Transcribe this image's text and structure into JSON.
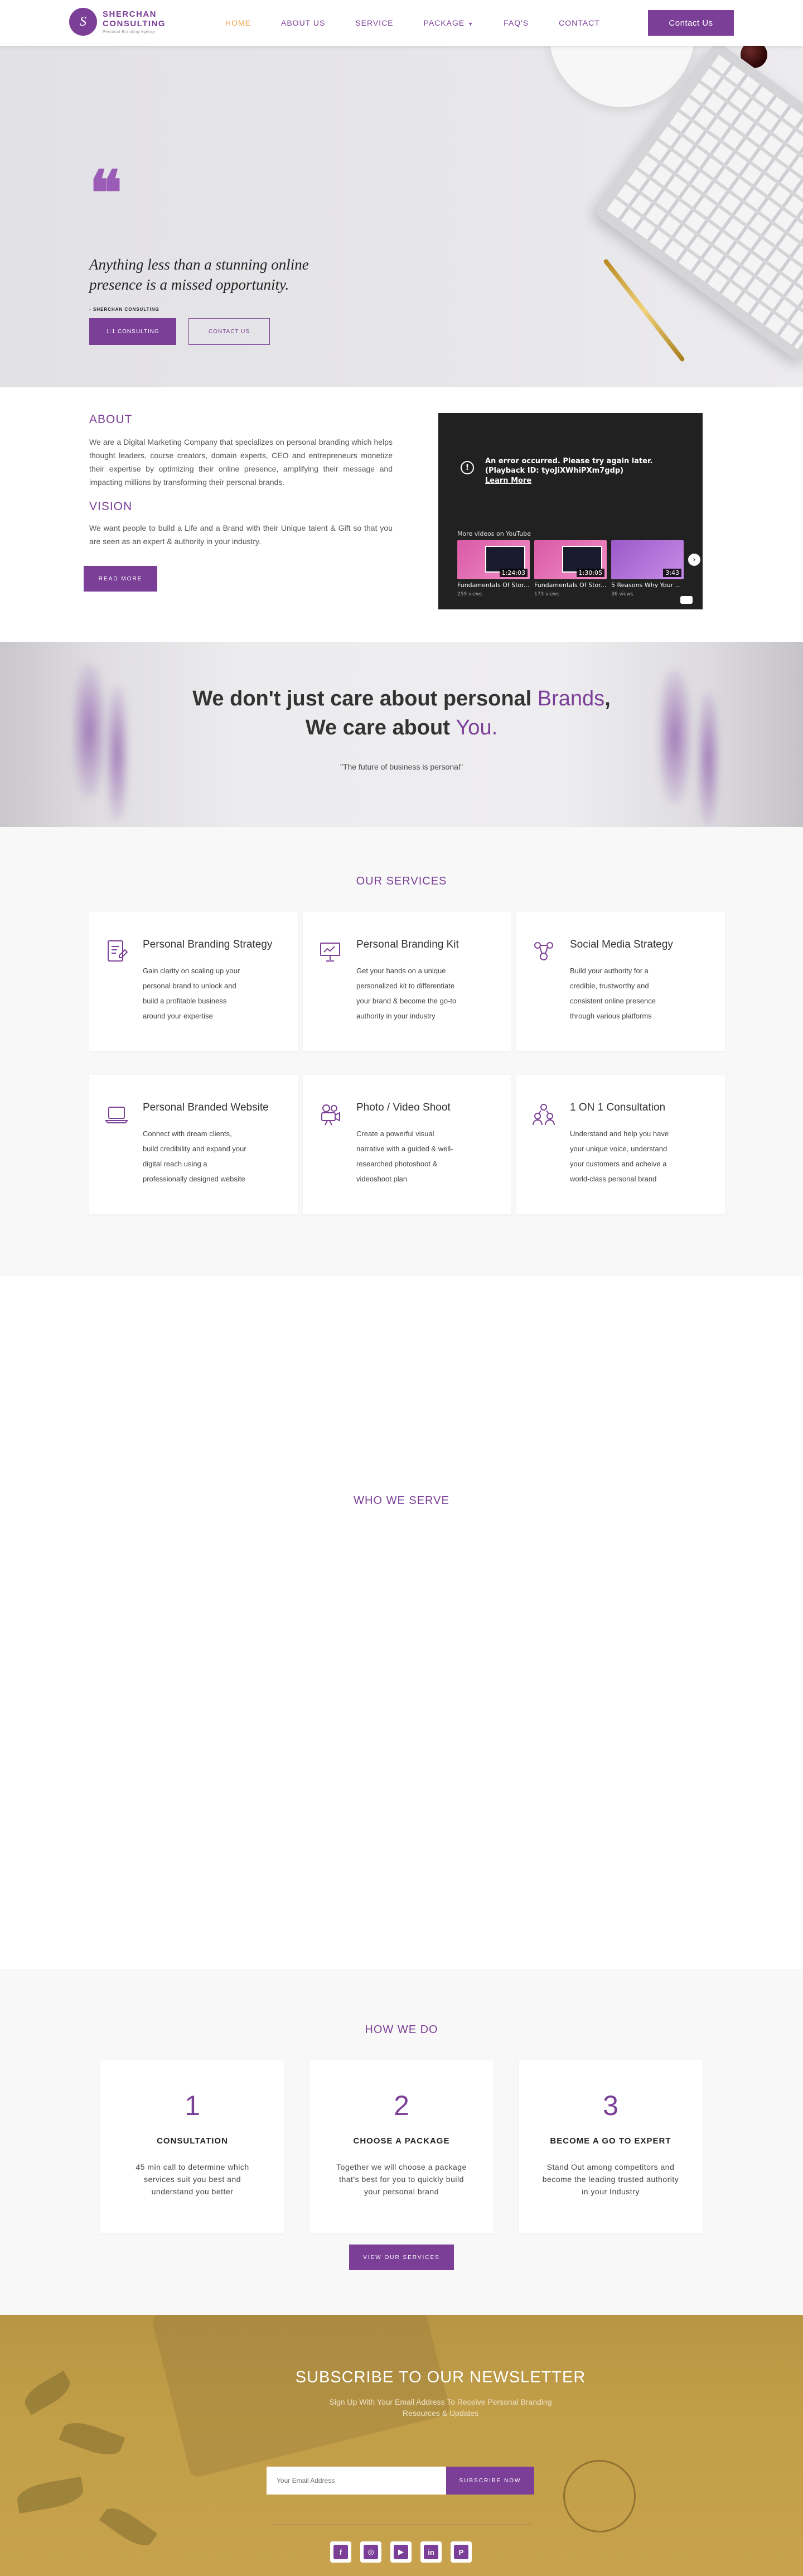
{
  "brand": {
    "mark": "S",
    "name_line1": "SHERCHAN",
    "name_line2": "CONSULTING",
    "tagline": "Personal Branding Agency"
  },
  "nav": {
    "items": [
      "HOME",
      "ABOUT US",
      "SERVICE",
      "PACKAGE",
      "FAQ'S",
      "CONTACT"
    ],
    "active": "HOME",
    "cta": "Contact Us"
  },
  "hero": {
    "quote_glyph": "❝",
    "quote": "Anything less than a stunning online presence is a missed opportunity.",
    "signature": "- SHERCHAN CONSULTING",
    "button_primary": "1:1 CONSULTING",
    "button_secondary": "CONTACT US"
  },
  "about": {
    "about_title": "ABOUT",
    "about_text": "We are a Digital Marketing Company that specializes on personal branding which helps thought leaders, course creators, domain experts, CEO and entrepreneurs monetize their expertise by optimizing their online presence, amplifying their message and impacting millions by transforming their personal brands.",
    "vision_title": "VISION",
    "vision_text": "We want people to build a Life and a Brand with their Unique talent & Gift so that you are seen as an expert & authority in your industry.",
    "read_more": "READ MORE"
  },
  "video": {
    "error": "An error occurred. Please try again later. (Playback ID: tyoJiXWhiPXm7gdp)",
    "learn_more": "Learn More",
    "more_videos": "More videos on YouTube",
    "thumbs": [
      {
        "title": "Fundamentals Of Stor...",
        "views": "259 views",
        "duration": "1:24:03"
      },
      {
        "title": "Fundamentals Of Stor...",
        "views": "173 views",
        "duration": "1:30:05"
      },
      {
        "title": "5 Reasons Why Your ...",
        "views": "36 views",
        "duration": "3:43"
      }
    ]
  },
  "banner": {
    "line1_a": "We don't just care about personal ",
    "line1_hl": "Brands",
    "line1_b": ",",
    "line2_a": "We care about ",
    "line2_hl": "You.",
    "subtitle": "\"The future of business is personal\""
  },
  "services": {
    "title": "OUR SERVICES",
    "cards": [
      {
        "icon": "strategy-document-icon",
        "title": "Personal Branding Strategy",
        "text": "Gain clarity on scaling up your personal brand to unlock and build a profitable business around your expertise"
      },
      {
        "icon": "presentation-board-icon",
        "title": "Personal Branding Kit",
        "text": "Get your hands on a unique personalized kit to differentiate your brand & become the go-to authority in your industry"
      },
      {
        "icon": "social-network-icon",
        "title": "Social Media Strategy",
        "text": "Build your authority for a credible, trustworthy and consistent online presence through various platforms"
      },
      {
        "icon": "laptop-icon",
        "title": "Personal Branded Website",
        "text": "Connect with dream clients, build credibility and expand your digital reach using a professionally designed website"
      },
      {
        "icon": "video-camera-icon",
        "title": "Photo / Video Shoot",
        "text": "Create a powerful visual narrative with a guided & well-researched photoshoot & videoshoot plan"
      },
      {
        "icon": "people-consultation-icon",
        "title": "1 ON 1 Consultation",
        "text": "Understand and help you have your unique voice, understand your customers and acheive a world-class personal brand"
      }
    ]
  },
  "who": {
    "title": "WHO WE SERVE"
  },
  "how": {
    "title": "HOW WE DO",
    "steps": [
      {
        "num": "1",
        "title": "CONSULTATION",
        "text": "45 min call to determine which services suit you best and understand you better"
      },
      {
        "num": "2",
        "title": "CHOOSE A PACKAGE",
        "text": "Together we will choose a package that's best for you to quickly build your personal brand"
      },
      {
        "num": "3",
        "title": "BECOME A GO TO EXPERT",
        "text": "Stand Out among competitors and become the leading trusted authority in your Industry"
      }
    ],
    "button": "VIEW OUR SERVICES"
  },
  "newsletter": {
    "title": "SUBSCRIBE TO OUR NEWSLETTER",
    "sub_line1": "Sign Up With Your Email Address To Receive Personal Branding",
    "sub_line2": "Resources & Updates",
    "placeholder": "Your Email Address",
    "button": "SUBSCRIBE NOW",
    "social": [
      {
        "icon": "facebook-icon",
        "glyph": "f"
      },
      {
        "icon": "instagram-icon",
        "glyph": "◎"
      },
      {
        "icon": "youtube-icon",
        "glyph": "▶"
      },
      {
        "icon": "linkedin-icon",
        "glyph": "in"
      },
      {
        "icon": "pinterest-icon",
        "glyph": "P"
      }
    ]
  },
  "colors": {
    "accent": "#7b3f98",
    "nav_active": "#f0a34b",
    "newsletter_bg": "#c29e48"
  }
}
